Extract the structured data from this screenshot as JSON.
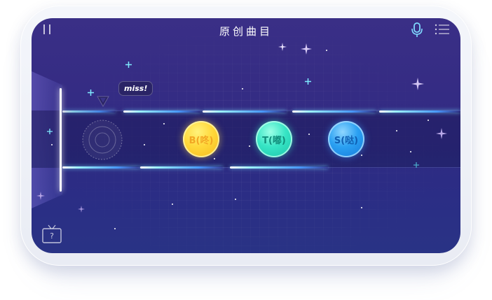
{
  "header": {
    "title": "原创曲目"
  },
  "icons": {
    "pause": "pause-icon",
    "mic": "microphone-icon",
    "menu": "menu-list-icon",
    "tv_help": "tv-help-icon",
    "target": "target-ring-icon",
    "pointer": "pointer-arrow-icon"
  },
  "feedback": {
    "miss_label": "miss!"
  },
  "notes": [
    {
      "label": "B(咚)",
      "color": "#ffd83a"
    },
    {
      "label": "T(嘟)",
      "color": "#37e5c5"
    },
    {
      "label": "S(哒)",
      "color": "#2aa0f2"
    }
  ],
  "help": {
    "tv_label": "?"
  },
  "colors": {
    "background": "#332d84",
    "track_glow": "#9ef3ff",
    "judge_line": "#ffffff"
  }
}
